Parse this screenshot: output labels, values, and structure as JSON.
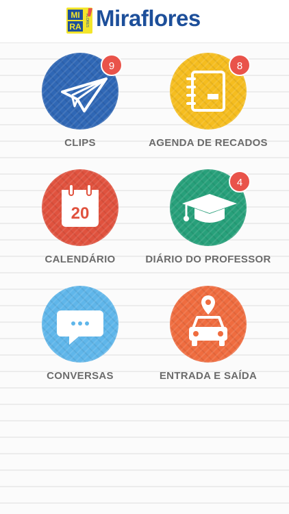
{
  "app": {
    "logo_badge_lines": [
      "MI",
      "RA"
    ],
    "logo_badge_small": "FLORES",
    "logo_text": "Miraflores"
  },
  "menu": {
    "items": [
      {
        "label": "CLIPS",
        "badge": "9",
        "color": "#2f67b5",
        "icon": "paper-plane-icon"
      },
      {
        "label": "AGENDA DE RECADOS",
        "badge": "8",
        "color": "#f5bd1f",
        "icon": "notebook-icon"
      },
      {
        "label": "CALENDÁRIO",
        "badge": "",
        "color": "#e0523e",
        "icon": "calendar-icon",
        "calendar_day": "20"
      },
      {
        "label": "DIÁRIO DO PROFESSOR",
        "badge": "4",
        "color": "#27a07a",
        "icon": "graduation-cap-icon"
      },
      {
        "label": "CONVERSAS",
        "badge": "",
        "color": "#5fb6ea",
        "icon": "chat-bubble-icon"
      },
      {
        "label": "ENTRADA E SAÍDA",
        "badge": "",
        "color": "#ef6c3f",
        "icon": "car-location-icon"
      }
    ]
  }
}
